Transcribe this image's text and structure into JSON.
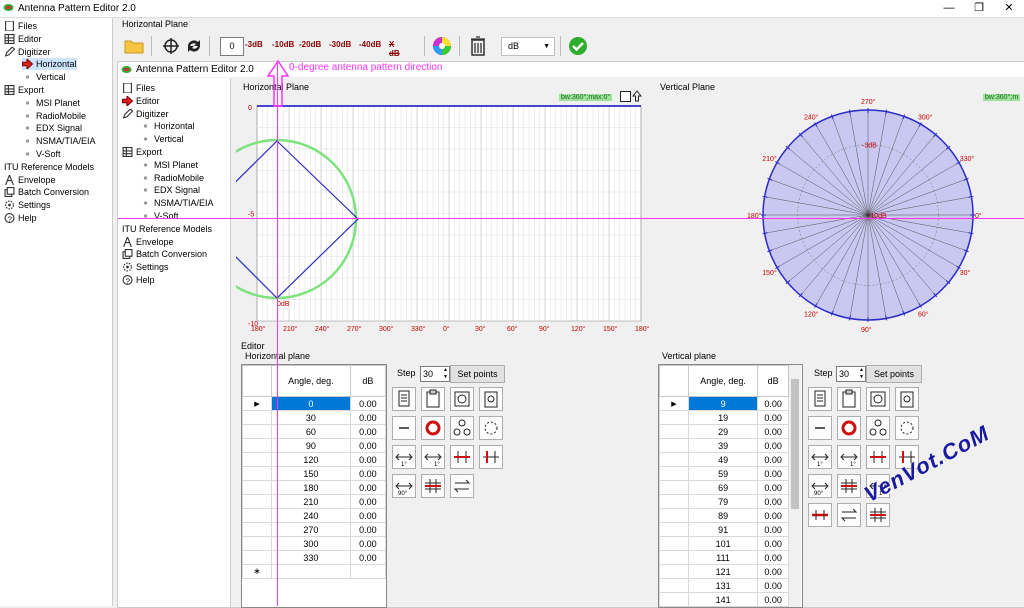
{
  "window": {
    "title": "Antenna Pattern Editor 2.0"
  },
  "tree": {
    "items": [
      {
        "label": "Files",
        "icon": "document-icon"
      },
      {
        "label": "Editor",
        "icon": "grid-icon"
      },
      {
        "label": "Digitizer",
        "icon": "pencil-icon"
      },
      {
        "label": "Horizontal",
        "icon": "red-arrow-icon"
      },
      {
        "label": "Vertical",
        "icon": "dot-icon"
      },
      {
        "label": "Export",
        "icon": "grid-icon"
      },
      {
        "label": "MSI Planet",
        "icon": "dot-icon"
      },
      {
        "label": "RadioMobile",
        "icon": "dot-icon"
      },
      {
        "label": "EDX Signal",
        "icon": "dot-icon"
      },
      {
        "label": "NSMA/TIA/EIA",
        "icon": "dot-icon"
      },
      {
        "label": "V-Soft",
        "icon": "dot-icon"
      },
      {
        "label": "ITU Reference Models",
        "icon": ""
      },
      {
        "label": "Envelope",
        "icon": "tower-icon"
      },
      {
        "label": "Batch Conversion",
        "icon": "batch-icon"
      },
      {
        "label": "Settings",
        "icon": "gear-icon"
      },
      {
        "label": "Help",
        "icon": "help-icon"
      }
    ]
  },
  "inner_tree": {
    "items": [
      {
        "label": "Files",
        "icon": "document-icon"
      },
      {
        "label": "Editor",
        "icon": "red-arrow-icon"
      },
      {
        "label": "Digitizer",
        "icon": "pencil-icon"
      },
      {
        "label": "Horizontal",
        "icon": "dot-icon"
      },
      {
        "label": "Vertical",
        "icon": "dot-icon"
      },
      {
        "label": "Export",
        "icon": "grid-icon"
      },
      {
        "label": "MSI Planet",
        "icon": "dot-icon"
      },
      {
        "label": "RadioMobile",
        "icon": "dot-icon"
      },
      {
        "label": "EDX Signal",
        "icon": "dot-icon"
      },
      {
        "label": "NSMA/TIA/EIA",
        "icon": "dot-icon"
      },
      {
        "label": "V-Soft",
        "icon": "dot-icon"
      },
      {
        "label": "ITU Reference Models",
        "icon": ""
      },
      {
        "label": "Envelope",
        "icon": "tower-icon"
      },
      {
        "label": "Batch Conversion",
        "icon": "batch-icon"
      },
      {
        "label": "Settings",
        "icon": "gear-icon"
      },
      {
        "label": "Help",
        "icon": "help-icon"
      }
    ]
  },
  "header": {
    "group_title": "Horizontal Plane"
  },
  "toolbar": {
    "offset_value": "0",
    "db_buttons": [
      "-3dB",
      "-10dB",
      "-20dB",
      "-30dB",
      "-40dB",
      "X dB"
    ],
    "unit_select": "dB"
  },
  "inner_window": {
    "title": "Antenna Pattern Editor 2.0"
  },
  "annotation": {
    "direction_label": "0-degree antenna pattern direction"
  },
  "hplot": {
    "title": "Horizontal Plane",
    "badge": "bw:360°;max:0°",
    "y_ticks": [
      "0",
      "-5",
      "-10"
    ],
    "x_ticks": [
      "180°",
      "210°",
      "240°",
      "270°",
      "300°",
      "330°",
      "0°",
      "30°",
      "60°",
      "90°",
      "120°",
      "150°",
      "180°"
    ],
    "point_label": "0dB"
  },
  "vplot": {
    "title": "Vertical Plane",
    "badge": "bw:360°;m",
    "angle_labels": [
      "270°",
      "300°",
      "330°",
      "0°",
      "30°",
      "60°",
      "90°",
      "120°",
      "150°",
      "180°",
      "210°",
      "240°"
    ],
    "ring_labels": [
      "-3dB",
      "-10dB"
    ]
  },
  "editor": {
    "title": "Editor",
    "h_plane": {
      "label": "Horizontal plane",
      "step_label": "Step",
      "step_value": "30",
      "set_points": "Set points",
      "columns": [
        "Angle, deg.",
        "dB"
      ],
      "rows": [
        [
          "0",
          "0.00"
        ],
        [
          "30",
          "0.00"
        ],
        [
          "60",
          "0.00"
        ],
        [
          "90",
          "0.00"
        ],
        [
          "120",
          "0.00"
        ],
        [
          "150",
          "0.00"
        ],
        [
          "180",
          "0.00"
        ],
        [
          "210",
          "0.00"
        ],
        [
          "240",
          "0.00"
        ],
        [
          "270",
          "0.00"
        ],
        [
          "300",
          "0.00"
        ],
        [
          "330",
          "0.00"
        ]
      ]
    },
    "v_plane": {
      "label": "Vertical plane",
      "step_label": "Step",
      "step_value": "30",
      "set_points": "Set points",
      "columns": [
        "Angle, deg.",
        "dB"
      ],
      "rows": [
        [
          "9",
          "0.00"
        ],
        [
          "19",
          "0.00"
        ],
        [
          "29",
          "0.00"
        ],
        [
          "39",
          "0.00"
        ],
        [
          "49",
          "0.00"
        ],
        [
          "59",
          "0.00"
        ],
        [
          "69",
          "0.00"
        ],
        [
          "79",
          "0.00"
        ],
        [
          "89",
          "0.00"
        ],
        [
          "91",
          "0.00"
        ],
        [
          "101",
          "0.00"
        ],
        [
          "111",
          "0.00"
        ],
        [
          "121",
          "0.00"
        ],
        [
          "131",
          "0.00"
        ],
        [
          "141",
          "0.00"
        ]
      ]
    }
  },
  "watermark": "VenVot.CoM",
  "colors": {
    "accent": "#0078d7",
    "pattern": "#2b2bc8",
    "pink": "#ff33ff",
    "green": "#7ee27e",
    "polar_fill": "#c8c8f0"
  }
}
